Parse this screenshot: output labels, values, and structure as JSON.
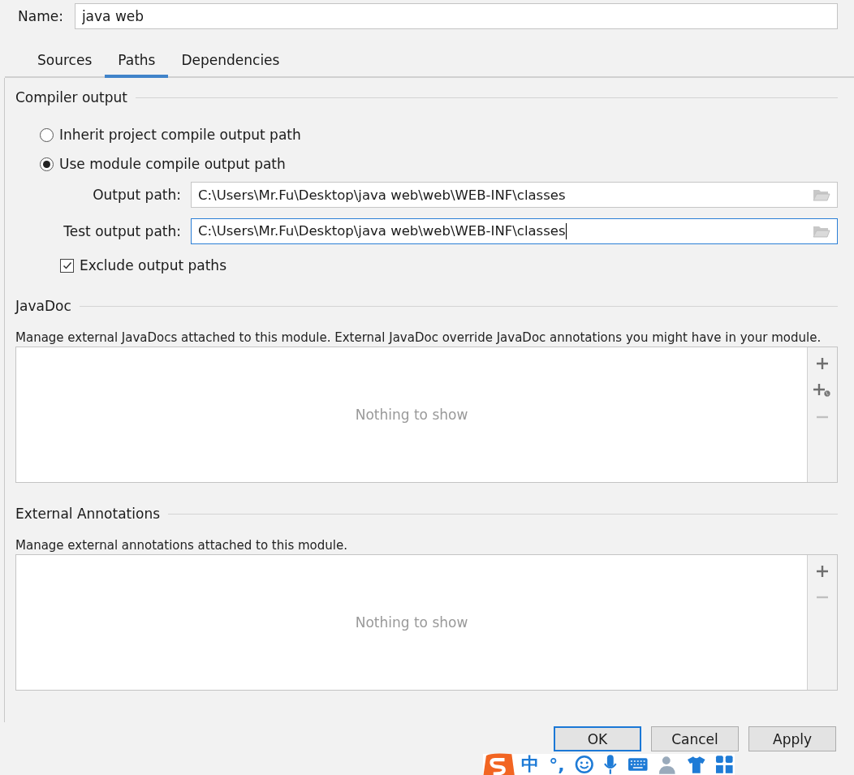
{
  "name_field": {
    "label": "Name:",
    "value": "java web"
  },
  "tabs": [
    {
      "label": "Sources",
      "selected": false
    },
    {
      "label": "Paths",
      "selected": true
    },
    {
      "label": "Dependencies",
      "selected": false
    }
  ],
  "compiler_output": {
    "title": "Compiler output",
    "options": [
      {
        "label": "Inherit project compile output path",
        "selected": false
      },
      {
        "label": "Use module compile output path",
        "selected": true
      }
    ],
    "paths": [
      {
        "label": "Output path:",
        "value": "C:\\Users\\Mr.Fu\\Desktop\\java web\\web\\WEB-INF\\classes",
        "focused": false
      },
      {
        "label": "Test output path:",
        "value": "C:\\Users\\Mr.Fu\\Desktop\\java web\\web\\WEB-INF\\classes",
        "focused": true
      }
    ],
    "exclude": {
      "label": "Exclude output paths",
      "checked": true
    }
  },
  "sections": [
    {
      "title": "JavaDoc",
      "description": "Manage external JavaDocs attached to this module. External JavaDoc override JavaDoc annotations you might have in your module.",
      "empty_text": "Nothing to show",
      "tools": [
        {
          "kind": "add",
          "disabled": false
        },
        {
          "kind": "add_url",
          "disabled": false
        },
        {
          "kind": "remove",
          "disabled": true
        }
      ]
    },
    {
      "title": "External Annotations",
      "description": "Manage external annotations attached to this module.",
      "empty_text": "Nothing to show",
      "tools": [
        {
          "kind": "add",
          "disabled": false
        },
        {
          "kind": "remove",
          "disabled": true
        }
      ]
    }
  ],
  "buttons": [
    {
      "label": "OK",
      "default": true
    },
    {
      "label": "Cancel",
      "default": false
    },
    {
      "label": "Apply",
      "default": false
    }
  ],
  "ime_toolbar": {
    "mode": "中",
    "punctuation": "°,"
  }
}
